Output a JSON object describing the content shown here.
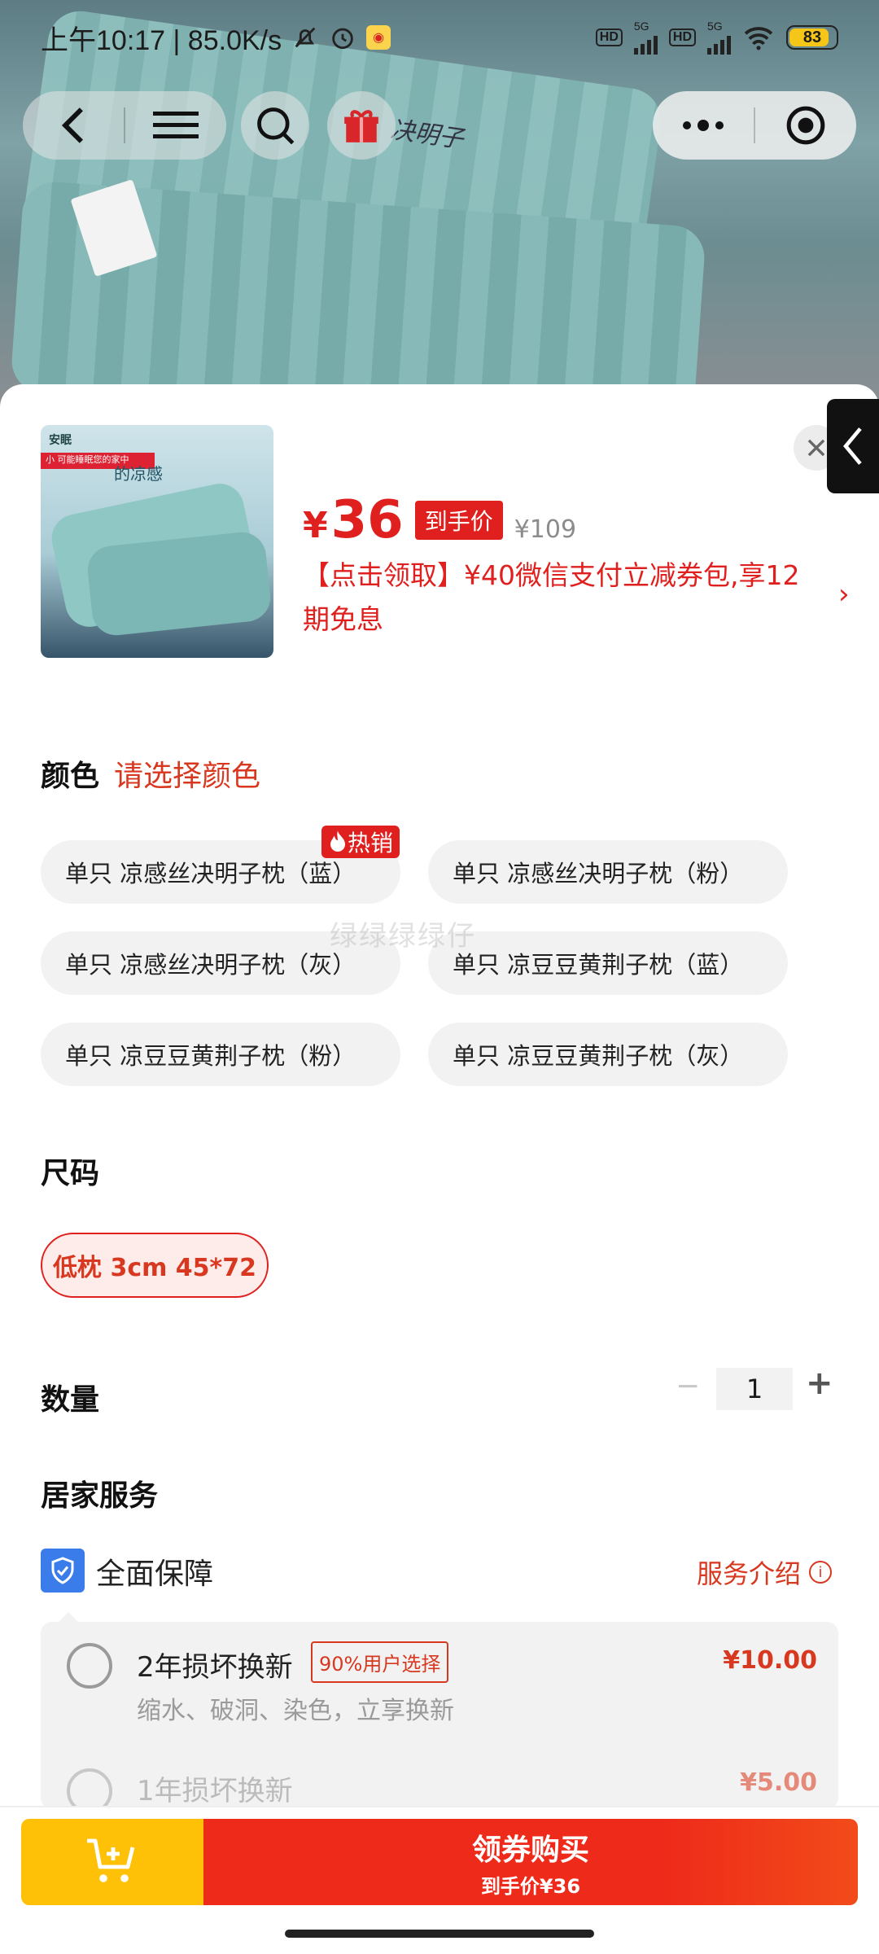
{
  "status_bar": {
    "time_speed": "上午10:17 | 85.0K/s",
    "net1": "HD",
    "sig1": "5G",
    "net2": "HD",
    "sig2": "5G",
    "battery": "83"
  },
  "hero": {
    "overlay_text": "决明子"
  },
  "product": {
    "price_symbol": "¥",
    "price": "36",
    "price_tag": "到手价",
    "original_price": "¥109",
    "promo_text": "【点击领取】¥40微信支付立减券包,享12期免息",
    "promo_arrow": "›",
    "thumb_brand": "安眠",
    "thumb_banner": "小 可能睡眠您的家中",
    "thumb_title": "的凉感"
  },
  "color_section": {
    "title": "颜色",
    "hint": "请选择颜色",
    "hot_label": "热销",
    "options": [
      "单只 凉感丝决明子枕（蓝）",
      "单只 凉感丝决明子枕（粉）",
      "单只 凉感丝决明子枕（灰）",
      "单只 凉豆豆黄荆子枕（蓝）",
      "单只 凉豆豆黄荆子枕（粉）",
      "单只 凉豆豆黄荆子枕（灰）"
    ]
  },
  "watermark": "绿绿绿绿仔",
  "size_section": {
    "title": "尺码",
    "selected": "低枕 3cm 45*72"
  },
  "quantity_section": {
    "title": "数量",
    "minus": "−",
    "value": "1",
    "plus": "+"
  },
  "service_section": {
    "title": "居家服务",
    "guarantee_label": "全面保障",
    "intro_link": "服务介绍",
    "info_icon": "i",
    "options": [
      {
        "title": "2年损坏换新",
        "badge": "90%用户选择",
        "price": "¥10.00",
        "desc": "缩水、破洞、染色，立享换新"
      },
      {
        "title": "1年损坏换新",
        "price": "¥5.00"
      }
    ]
  },
  "footer": {
    "buy_label": "领券购买",
    "buy_sub": "到手价¥36"
  },
  "colors": {
    "accent_red": "#e0201e",
    "cart_yellow": "#ffc107",
    "shield_blue": "#3a7dea"
  }
}
